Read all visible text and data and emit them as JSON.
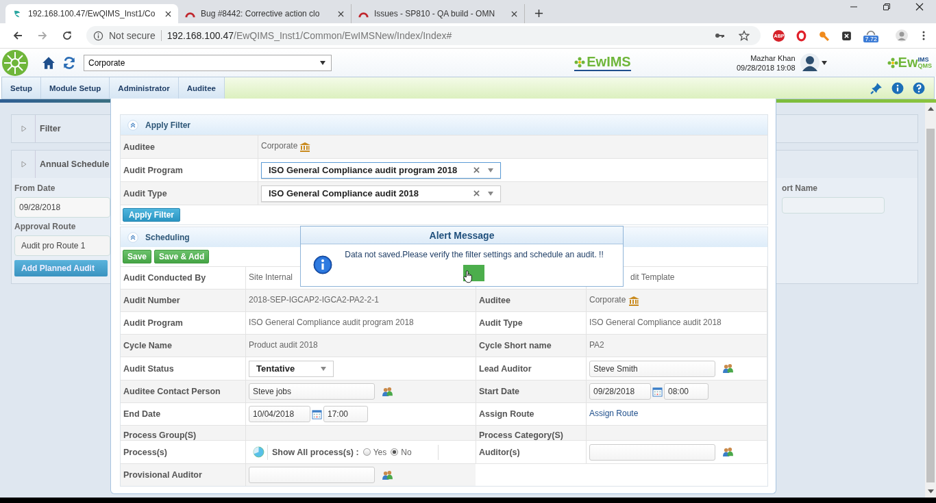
{
  "browser": {
    "tabs": [
      {
        "title": "192.168.100.47/EwQIMS_Inst1/Co",
        "selected": true
      },
      {
        "title": "Bug #8442: Corrective action clo",
        "selected": false
      },
      {
        "title": "Issues - SP810 - QA build - OMN",
        "selected": false
      }
    ],
    "security": "Not secure",
    "url_host": "192.168.100.47",
    "url_path": "/EwQIMS_Inst1/Common/EwIMSNew/Index/Index#",
    "abp": "ABP",
    "badge": "7.72"
  },
  "app_header": {
    "site": "Corporate",
    "logo": "EwIMS",
    "user_name": "Mazhar Khan",
    "datetime": "09/28/2018 19:08",
    "brand": {
      "main": "Ew",
      "top": "IMS",
      "bottom": "QMS"
    }
  },
  "menu": [
    {
      "label": "Setup"
    },
    {
      "label": "Module Setup"
    },
    {
      "label": "Administrator"
    },
    {
      "label": "Auditee"
    }
  ],
  "background": {
    "filter_title": "Filter",
    "schedule_title": "Annual Schedule",
    "from_date_label": "From Date",
    "from_date": "09/28/2018",
    "route_label": "Approval Route",
    "route": "Audit pro Route 1",
    "add_button": "Add Planned Audit",
    "column_fragment": "ort Name"
  },
  "apply_filter": {
    "title": "Apply Filter",
    "rows": [
      {
        "label": "Auditee",
        "kind": "building",
        "value": "Corporate"
      },
      {
        "label": "Audit Program",
        "kind": "combo",
        "value": "ISO General Compliance audit program 2018",
        "focused": true
      },
      {
        "label": "Audit Type",
        "kind": "combo",
        "value": "ISO General Compliance audit 2018",
        "focused": false
      }
    ],
    "button": "Apply Filter"
  },
  "scheduling": {
    "title": "Scheduling",
    "buttons": [
      "Save",
      "Save & Add"
    ],
    "rows": [
      {
        "cells": [
          {
            "label": "Audit Conducted By",
            "kind": "text",
            "value": "Site Internal"
          },
          {
            "kind": "text",
            "value": "dit Template"
          }
        ]
      },
      {
        "cells": [
          {
            "label": "Audit Number",
            "kind": "text",
            "value": "2018-SEP-IGCAP2-IGCA2-PA2-2-1"
          },
          {
            "label": "Auditee",
            "kind": "building",
            "value": "Corporate"
          }
        ]
      },
      {
        "cells": [
          {
            "label": "Audit Program",
            "kind": "text",
            "value": "ISO General Compliance audit program 2018"
          },
          {
            "label": "Audit Type",
            "kind": "text",
            "value": "ISO General Compliance audit 2018"
          }
        ]
      },
      {
        "cells": [
          {
            "label": "Cycle Name",
            "kind": "text",
            "value": "Product audit 2018"
          },
          {
            "label": "Cycle Short name",
            "kind": "text",
            "value": "PA2"
          }
        ]
      },
      {
        "cells": [
          {
            "label": "Audit Status",
            "kind": "select",
            "value": "Tentative"
          },
          {
            "label": "Lead Auditor",
            "kind": "person",
            "value": "Steve Smith"
          }
        ]
      },
      {
        "cells": [
          {
            "label": "Auditee Contact Person",
            "kind": "person",
            "value": "Steve jobs"
          },
          {
            "label": "Start Date",
            "kind": "datetime",
            "date": "09/28/2018",
            "time": "08:00"
          }
        ]
      },
      {
        "cells": [
          {
            "label": "End Date",
            "kind": "datetime",
            "date": "10/04/2018",
            "time": "17:00"
          },
          {
            "label": "Assign Route",
            "kind": "link",
            "value": "Assign Route"
          }
        ]
      },
      {
        "cells": [
          {
            "label": "Process Group(S)"
          },
          {
            "label": "Process Category(S)"
          }
        ]
      },
      {
        "cells": [
          {
            "label": "Process(s)",
            "kind": "radios",
            "caption": "Show All process(s) :",
            "options": [
              {
                "label": "Yes",
                "selected": false
              },
              {
                "label": "No",
                "selected": true
              }
            ]
          },
          {
            "label": "Auditor(s)",
            "kind": "person"
          }
        ]
      },
      {
        "cells": [
          {
            "label": "Provisional Auditor",
            "kind": "person"
          }
        ]
      }
    ]
  },
  "alert": {
    "title": "Alert Message",
    "message": "Data not saved.Please verify the filter settings and schedule an audit. !!"
  }
}
